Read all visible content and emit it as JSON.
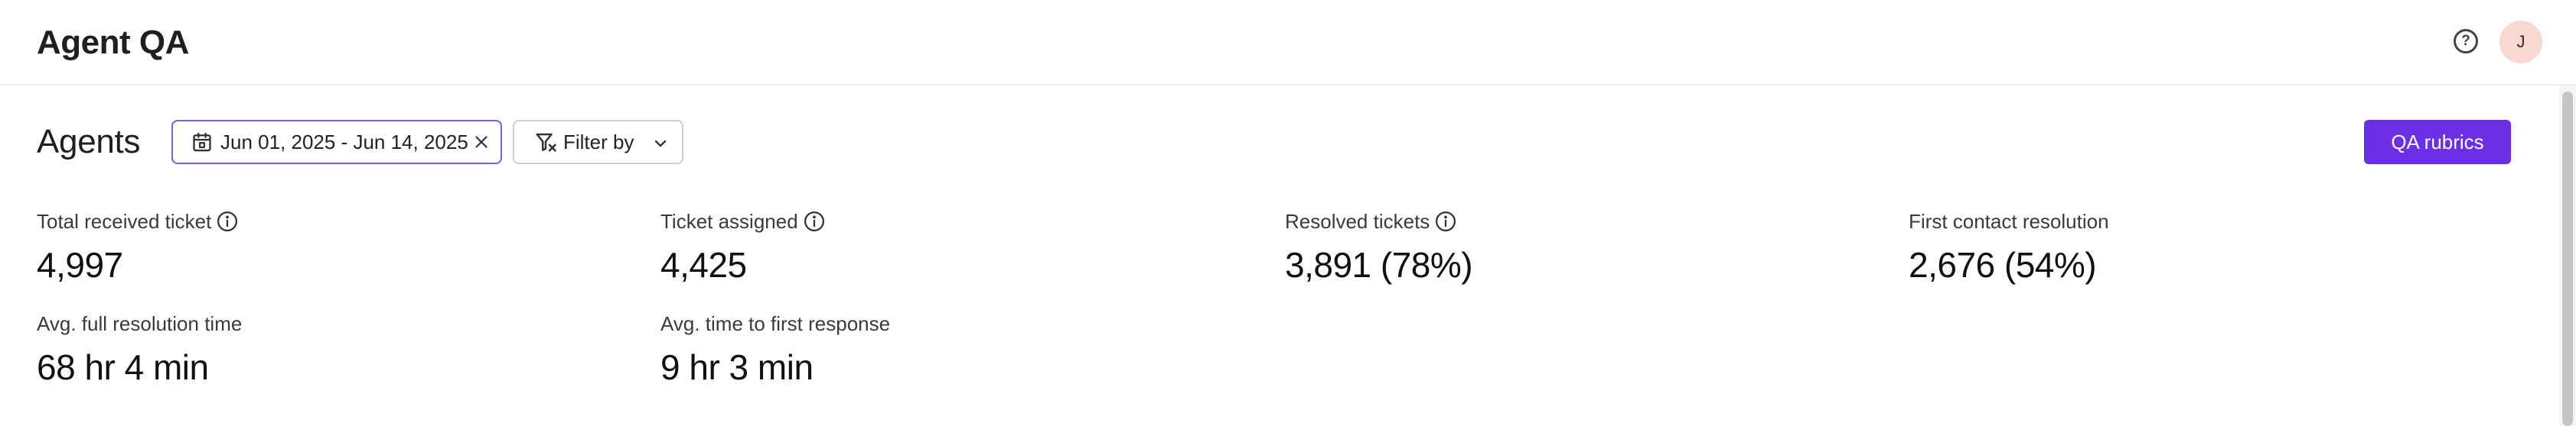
{
  "header": {
    "title": "Agent QA",
    "help_icon": "question-circle-icon",
    "avatar_initial": "J",
    "avatar_color": "#f7d9d2"
  },
  "toolbar": {
    "section_title": "Agents",
    "date_range": "Jun 01, 2025 - Jun 14, 2025",
    "filter_label": "Filter by",
    "primary_button": "QA rubrics",
    "accent_color": "#6d2fe6"
  },
  "metrics": [
    {
      "label": "Total received ticket",
      "value": "4,997",
      "has_info": true
    },
    {
      "label": "Ticket assigned",
      "value": "4,425",
      "has_info": true
    },
    {
      "label": "Resolved tickets",
      "value": "3,891 (78%)",
      "has_info": true
    },
    {
      "label": "First contact resolution",
      "value": "2,676 (54%)",
      "has_info": false
    },
    {
      "label": "Avg. full resolution time",
      "value": "68 hr 4 min",
      "has_info": false
    },
    {
      "label": "Avg. time to first response",
      "value": "9 hr 3 min",
      "has_info": false
    }
  ]
}
